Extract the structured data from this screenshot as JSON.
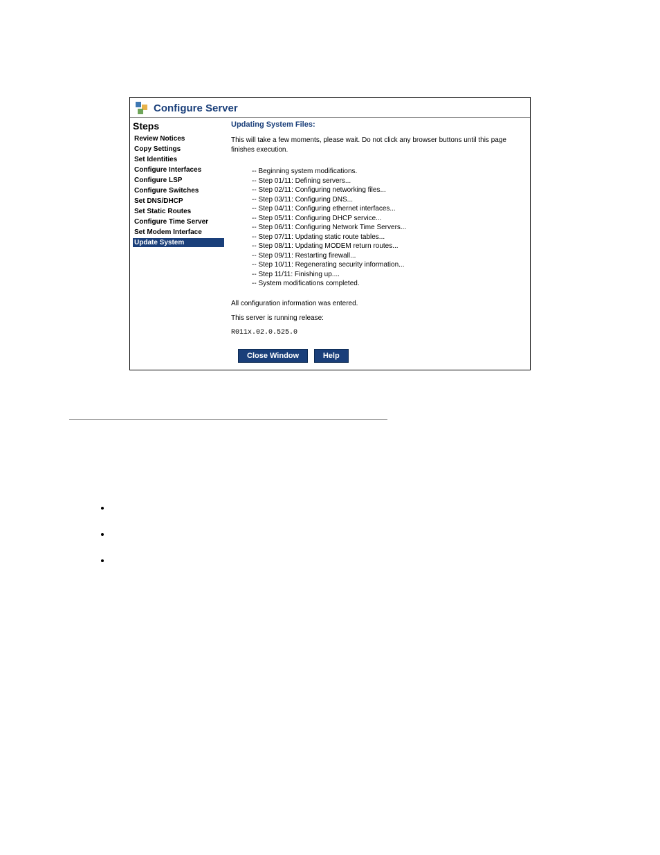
{
  "dialog": {
    "title": "Configure Server",
    "steps_heading": "Steps",
    "steps": [
      {
        "label": "Review Notices",
        "active": false
      },
      {
        "label": "Copy Settings",
        "active": false
      },
      {
        "label": "Set Identities",
        "active": false
      },
      {
        "label": "Configure Interfaces",
        "active": false
      },
      {
        "label": "Configure LSP",
        "active": false
      },
      {
        "label": "Configure Switches",
        "active": false
      },
      {
        "label": "Set DNS/DHCP",
        "active": false
      },
      {
        "label": "Set Static Routes",
        "active": false
      },
      {
        "label": "Configure Time Server",
        "active": false
      },
      {
        "label": "Set Modem Interface",
        "active": false
      },
      {
        "label": "Update System",
        "active": true
      }
    ],
    "main": {
      "heading": "Updating System Files:",
      "intro": "This will take a few moments, please wait. Do not click any browser buttons until this page finishes execution.",
      "log": [
        "-- Beginning system modifications.",
        "-- Step 01/11: Defining servers...",
        "-- Step 02/11: Configuring networking files...",
        "-- Step 03/11: Configuring DNS...",
        "-- Step 04/11: Configuring ethernet interfaces...",
        "-- Step 05/11: Configuring DHCP service...",
        "-- Step 06/11: Configuring Network Time Servers...",
        "-- Step 07/11: Updating static route tables...",
        "-- Step 08/11: Updating MODEM return routes...",
        "-- Step 09/11: Restarting firewall...",
        "-- Step 10/11: Regenerating security information...",
        "-- Step 11/11: Finishing up....",
        "-- System modifications completed."
      ],
      "entered": "All configuration information was entered.",
      "running": "This server is running release:",
      "release": "R011x.02.0.525.0",
      "buttons": {
        "close": "Close Window",
        "help": "Help"
      }
    }
  },
  "doc": {
    "bullets": [
      "",
      "",
      ""
    ]
  }
}
